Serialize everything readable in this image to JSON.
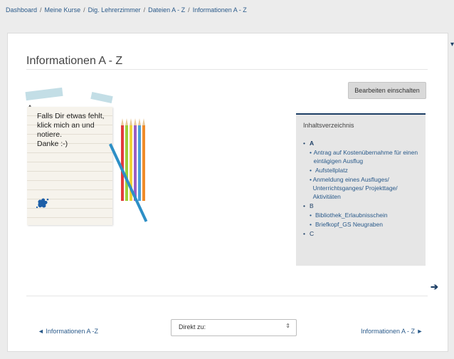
{
  "breadcrumb": [
    "Dashboard",
    "Meine Kurse",
    "Dig. Lehrerzimmer",
    "Dateien A - Z",
    "Informationen A - Z"
  ],
  "page": {
    "title": "Informationen A - Z",
    "edit_button": "Bearbeiten einschalten",
    "section_letter": "A"
  },
  "note": {
    "text": "Falls Dir etwas fehlt,\nklick mich an und\nnotiere.\nDanke :-)"
  },
  "toc": {
    "title": "Inhaltsverzeichnis",
    "sections": [
      {
        "label": "A",
        "items": [
          "Antrag auf Kostenübernahme für einen eintägigen Ausflug",
          "Aufstellplatz",
          "Anmeldung eines Ausfluges/ Unterrichtsganges/ Projekttage/ Aktivitäten"
        ]
      },
      {
        "label": "B",
        "items": [
          "Bibliothek_Erlaubnisschein",
          "Briefkopf_GS Neugraben"
        ]
      },
      {
        "label": "C",
        "items": []
      }
    ]
  },
  "nav": {
    "prev_label": "◄ Informationen A -Z",
    "jump_placeholder": "Direkt zu:",
    "next_label": "Informationen A - Z ►"
  },
  "colors": {
    "link": "#2a5a8a",
    "accent": "#1d3f66",
    "panel": "#e6e6e6"
  }
}
